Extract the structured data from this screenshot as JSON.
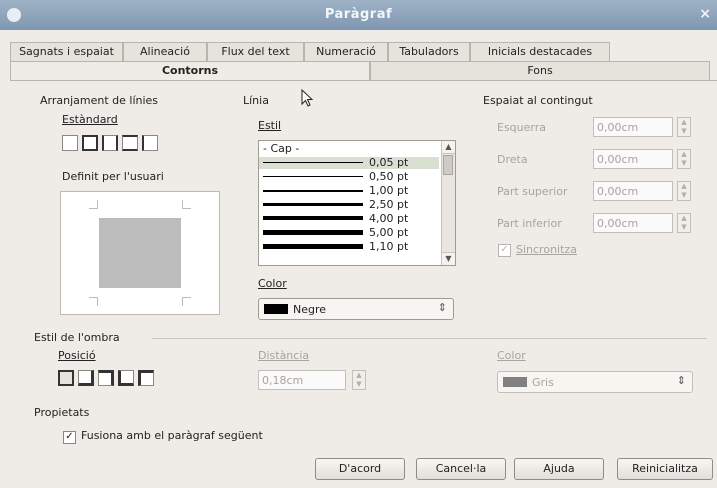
{
  "window": {
    "title": "Paràgraf",
    "close_glyph": "×"
  },
  "tabs": {
    "row1": [
      {
        "label": "Sagnats i espaiat"
      },
      {
        "label": "Alineació"
      },
      {
        "label": "Flux del text"
      },
      {
        "label": "Numeració"
      },
      {
        "label": "Tabuladors"
      },
      {
        "label": "Inicials destacades"
      }
    ],
    "row2": [
      {
        "label": "Contorns",
        "active": true
      },
      {
        "label": "Fons",
        "active": false
      }
    ]
  },
  "line_arrangement": {
    "title": "Arranjament de línies",
    "default_label": "Estàndard",
    "user_defined_label": "Definit per l'usuari"
  },
  "line": {
    "title": "Línia",
    "style_label": "Estil",
    "styles": [
      {
        "label": "- Cap -"
      },
      {
        "label": "0,05 pt",
        "selected": true
      },
      {
        "label": "0,50 pt"
      },
      {
        "label": "1,00 pt"
      },
      {
        "label": "2,50 pt"
      },
      {
        "label": "4,00 pt"
      },
      {
        "label": "5,00 pt"
      },
      {
        "label": "1,10 pt"
      }
    ],
    "color_label": "Color",
    "color_value": "Negre",
    "color_swatch": "#000000"
  },
  "spacing": {
    "title": "Espaiat al contingut",
    "rows": [
      {
        "label": "Esquerra",
        "value": "0,00cm"
      },
      {
        "label": "Dreta",
        "value": "0,00cm"
      },
      {
        "label": "Part superior",
        "value": "0,00cm"
      },
      {
        "label": "Part inferior",
        "value": "0,00cm"
      }
    ],
    "sync_label": "Sincronitza",
    "sync_checked": true
  },
  "shadow": {
    "title": "Estil de l'ombra",
    "position_label": "Posició",
    "distance_label": "Distància",
    "distance_value": "0,18cm",
    "color_label": "Color",
    "color_value": "Gris",
    "color_swatch": "#808080"
  },
  "properties": {
    "title": "Propietats",
    "merge_label": "Fusiona amb el paràgraf següent",
    "merge_checked": true
  },
  "buttons": {
    "ok": "D'acord",
    "cancel": "Cancel·la",
    "help": "Ajuda",
    "reset": "Reinicialitza"
  },
  "glyphs": {
    "check": "✓",
    "chevron": "⌃",
    "spin_up": "▲",
    "spin_down": "▼",
    "scroll_up": "▲",
    "scroll_down": "▼"
  }
}
